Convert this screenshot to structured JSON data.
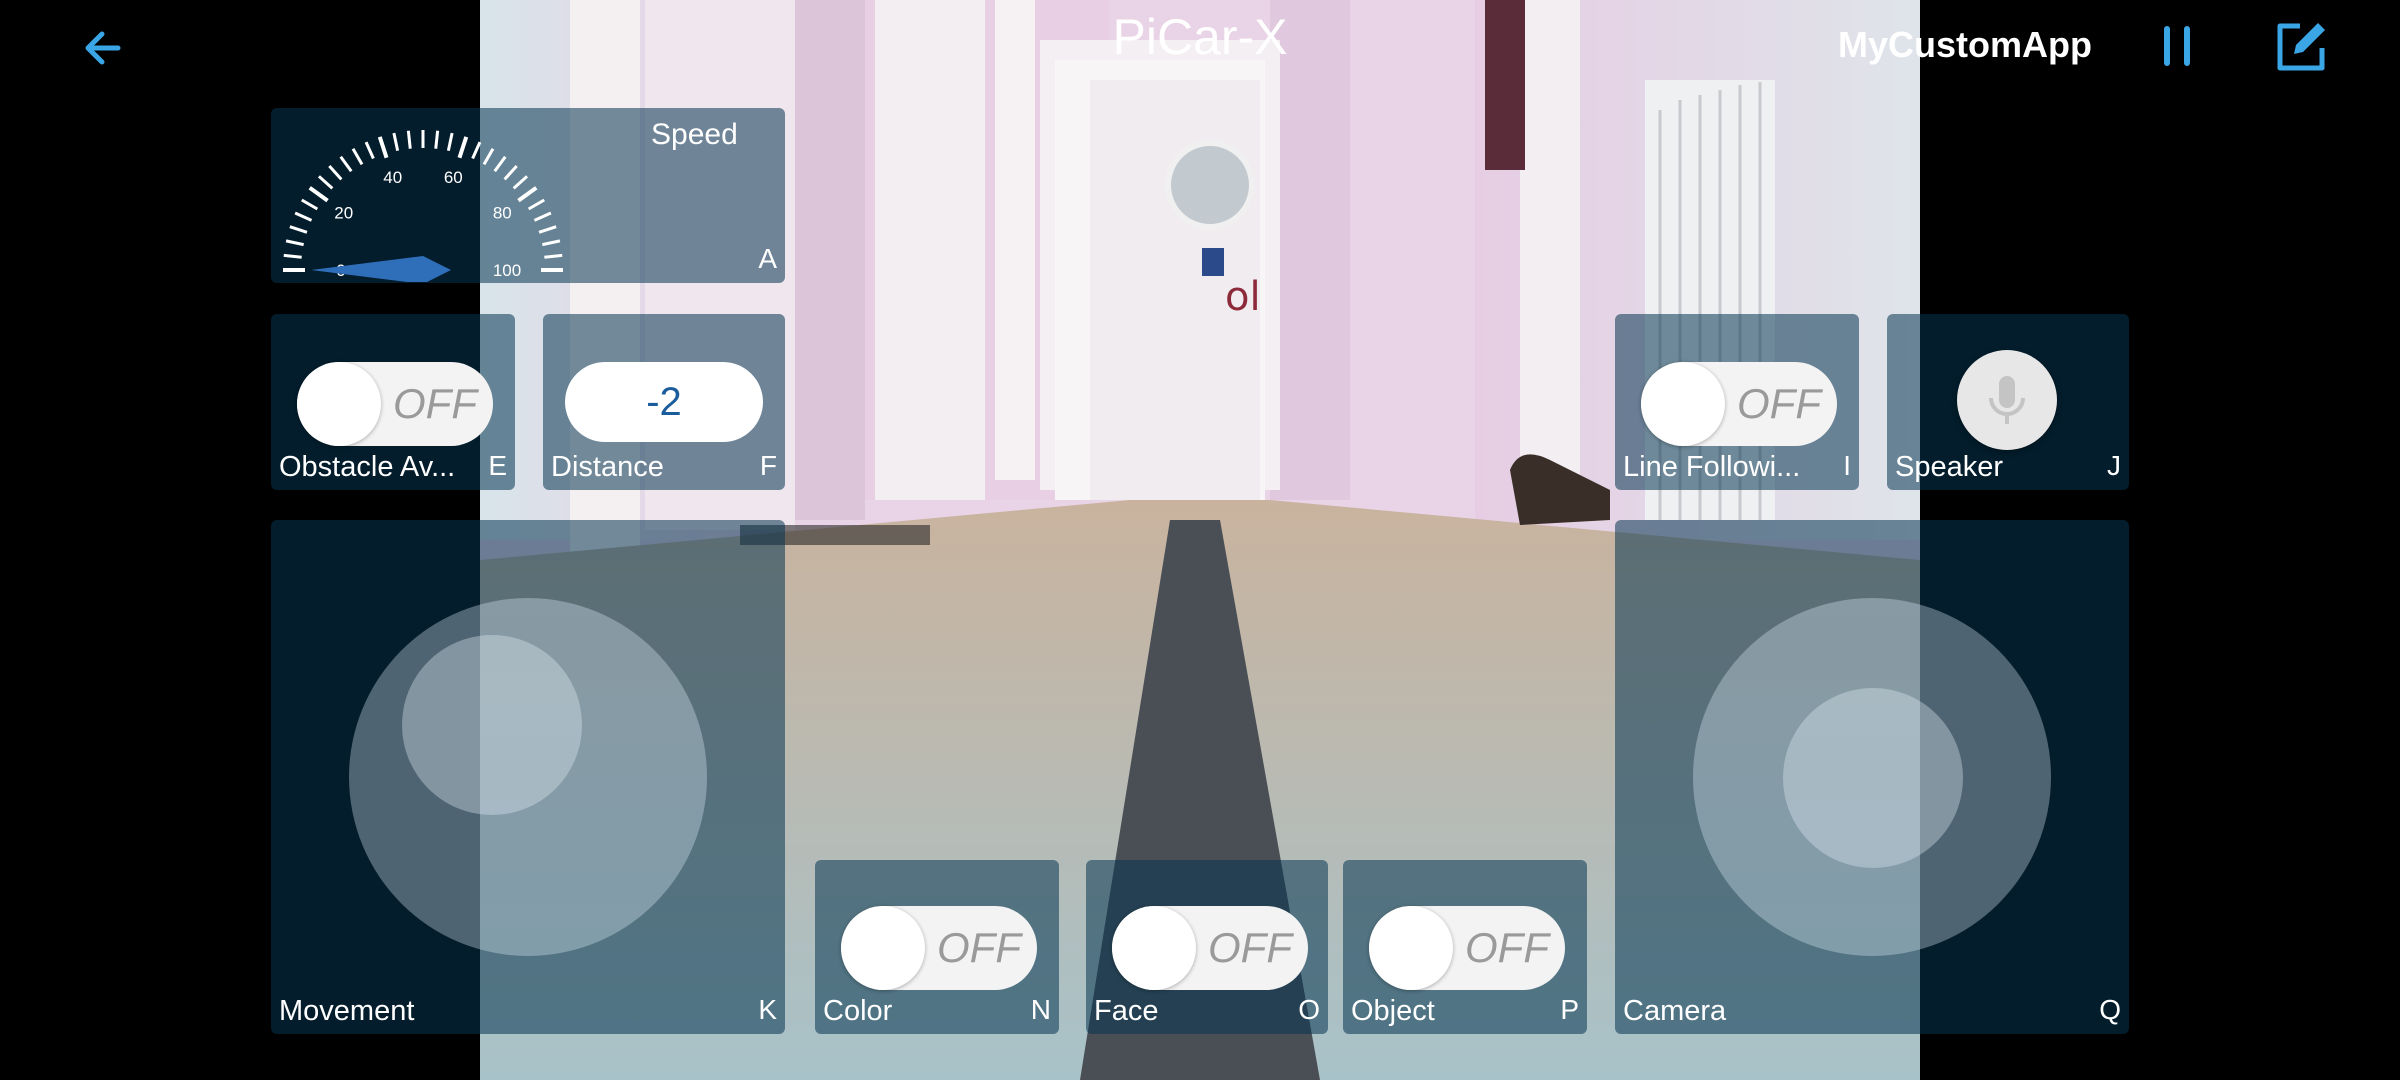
{
  "header": {
    "title": "PiCar-X",
    "app_name": "MyCustomApp",
    "back_icon": "arrow-left-icon",
    "pause_icon": "pause-icon",
    "edit_icon": "edit-icon",
    "accent_color": "#3ba6e6"
  },
  "widgets": {
    "speed": {
      "label": "Speed",
      "key": "A",
      "ticks": [
        "0",
        "20",
        "40",
        "60",
        "80",
        "100"
      ],
      "value": 0
    },
    "obstacle": {
      "label": "Obstacle Av...",
      "key": "E",
      "state": "OFF"
    },
    "distance": {
      "label": "Distance",
      "key": "F",
      "value": "-2"
    },
    "line_following": {
      "label": "Line Followi...",
      "key": "I",
      "state": "OFF"
    },
    "speaker": {
      "label": "Speaker",
      "key": "J",
      "icon": "microphone-icon"
    },
    "movement": {
      "label": "Movement",
      "key": "K"
    },
    "color": {
      "label": "Color",
      "key": "N",
      "state": "OFF"
    },
    "face": {
      "label": "Face",
      "key": "O",
      "state": "OFF"
    },
    "object": {
      "label": "Object",
      "key": "P",
      "state": "OFF"
    },
    "camera": {
      "label": "Camera",
      "key": "Q"
    }
  }
}
